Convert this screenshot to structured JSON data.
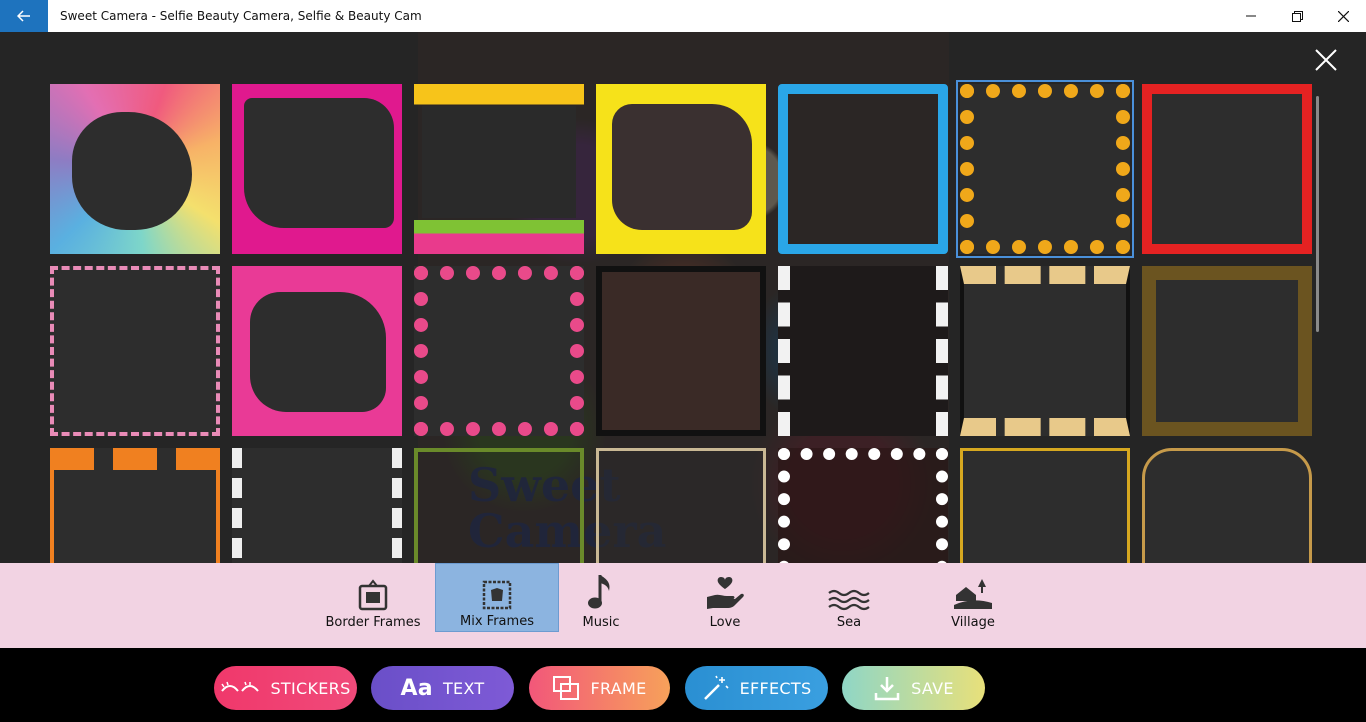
{
  "window": {
    "title": "Sweet Camera - Selfie Beauty Camera, Selfie & Beauty Cam"
  },
  "categories": [
    {
      "label": "Border Frames",
      "icon": "frame-icon"
    },
    {
      "label": "Mix Frames",
      "icon": "mix-frame-icon",
      "active": true
    },
    {
      "label": "Music",
      "icon": "music-note-icon"
    },
    {
      "label": "Love",
      "icon": "heart-hand-icon"
    },
    {
      "label": "Sea",
      "icon": "waves-icon"
    },
    {
      "label": "Village",
      "icon": "village-icon"
    }
  ],
  "toolbar": {
    "stickers": "STICKERS",
    "text": "TEXT",
    "frame": "FRAME",
    "effects": "EFFECTS",
    "save": "SAVE"
  },
  "overlay_text": {
    "line1": "Sweet",
    "line2": "Camera"
  },
  "colors": {
    "accent_blue": "#1e73be",
    "category_bg": "#f2d3e3",
    "category_active": "#8cb4e0"
  }
}
